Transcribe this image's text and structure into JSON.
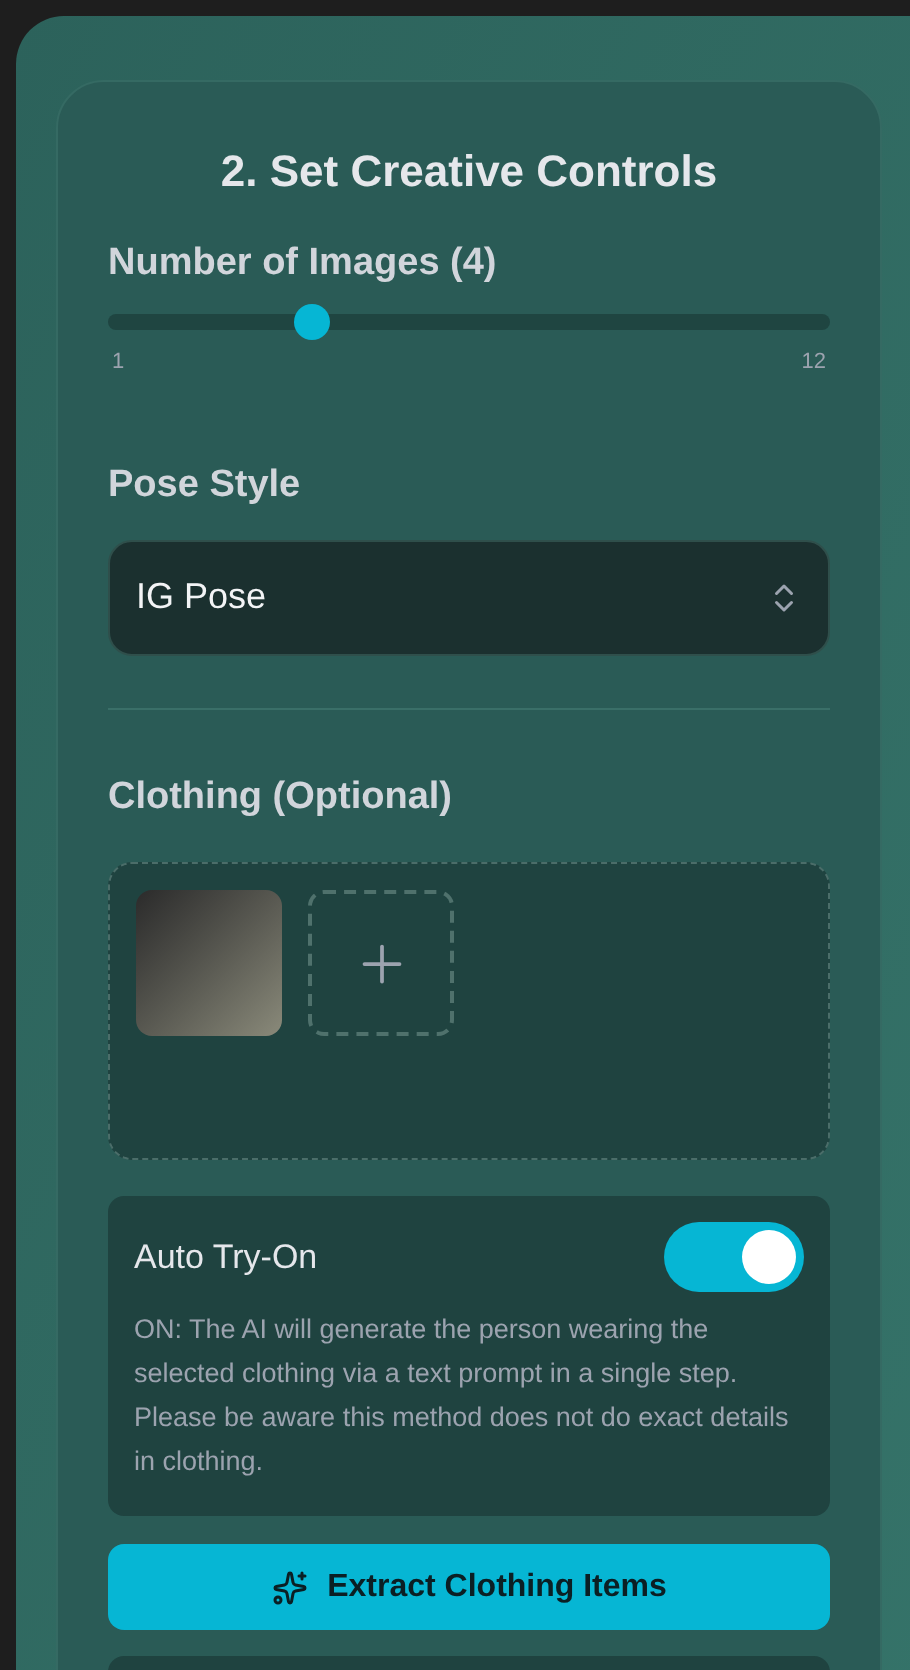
{
  "panel": {
    "title": "2. Set Creative Controls"
  },
  "images_slider": {
    "label": "Number of Images (4)",
    "level": 0.27,
    "min_label": "1",
    "max_label": "12"
  },
  "pose_style": {
    "label": "Pose Style",
    "value": "IG Pose"
  },
  "clothing": {
    "label": "Clothing (Optional)",
    "items": [
      {
        "kind": "photo"
      },
      {
        "kind": "add"
      }
    ]
  },
  "auto_try_on": {
    "label": "Auto Try-On",
    "on": true,
    "description": "ON: The AI will generate the person wearing the selected clothing via a text prompt in a single step. Please be aware this method does not do exact details in clothing."
  },
  "extract_button": {
    "label": "Extract Clothing Items"
  }
}
